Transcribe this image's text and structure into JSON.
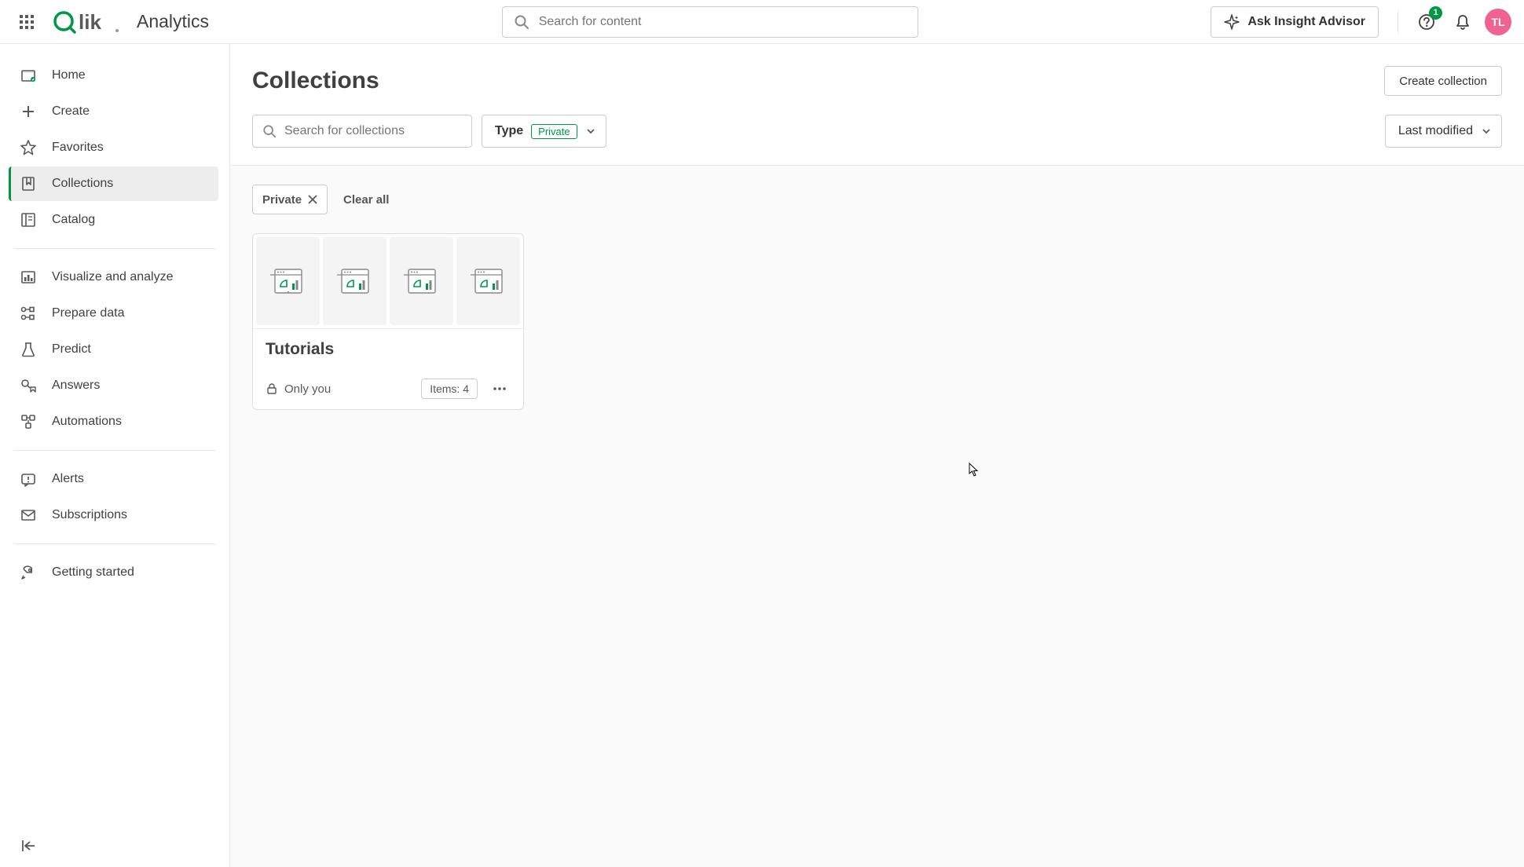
{
  "header": {
    "app_title": "Analytics",
    "search_placeholder": "Search for content",
    "insight_label": "Ask Insight Advisor",
    "help_badge": "1",
    "avatar_initials": "TL"
  },
  "sidebar": {
    "items": [
      {
        "label": "Home"
      },
      {
        "label": "Create"
      },
      {
        "label": "Favorites"
      },
      {
        "label": "Collections"
      },
      {
        "label": "Catalog"
      },
      {
        "label": "Visualize and analyze"
      },
      {
        "label": "Prepare data"
      },
      {
        "label": "Predict"
      },
      {
        "label": "Answers"
      },
      {
        "label": "Automations"
      },
      {
        "label": "Alerts"
      },
      {
        "label": "Subscriptions"
      },
      {
        "label": "Getting started"
      }
    ]
  },
  "main": {
    "title": "Collections",
    "create_button": "Create collection",
    "search_placeholder": "Search for collections",
    "type_label": "Type",
    "type_value": "Private",
    "sort_label": "Last modified",
    "filter_chip": "Private",
    "clear_all": "Clear all"
  },
  "card": {
    "title": "Tutorials",
    "visibility": "Only you",
    "items_label": "Items: 4"
  }
}
